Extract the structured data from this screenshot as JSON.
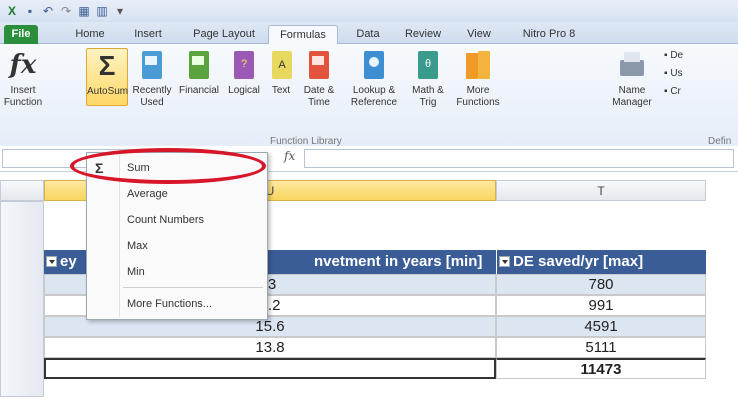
{
  "qa_bar": {
    "icons": [
      "excel-icon",
      "save-icon",
      "undo-icon",
      "redo-icon",
      "table-icon",
      "chart-icon",
      "customize-icon"
    ]
  },
  "tabs": [
    "File",
    "Home",
    "Insert",
    "Page Layout",
    "Formulas",
    "Data",
    "Review",
    "View",
    "Nitro Pro 8"
  ],
  "active_tab": "Formulas",
  "ribbon": {
    "insert_function": "Insert Function",
    "autosum": "AutoSum",
    "recently_used": "Recently Used",
    "financial": "Financial",
    "logical": "Logical",
    "text": "Text",
    "date_time": "Date & Time",
    "lookup_reference": "Lookup & Reference",
    "math_trig": "Math & Trig",
    "more_functions": "More Functions",
    "name_manager": "Name Manager",
    "function_library_label": "Function Library",
    "defined_names_label": "Defin",
    "define_name": "De",
    "use_in_formula": "Us",
    "create": "Cr"
  },
  "formula_bar": {
    "fx": "fx"
  },
  "autosum_menu": {
    "items": [
      "Sum",
      "Average",
      "Count Numbers",
      "Max",
      "Min",
      "More Functions..."
    ]
  },
  "sheet": {
    "col_u": "U",
    "col_t": "T",
    "header_left": "ey",
    "header_u": "nvetment in years [min]",
    "header_t": "DE saved/yr [max]",
    "rows": [
      {
        "u": ".3",
        "t": "780"
      },
      {
        "u": "2.2",
        "t": "991"
      },
      {
        "u": "15.6",
        "t": "4591"
      },
      {
        "u": "13.8",
        "t": "5111"
      }
    ],
    "total": "11473"
  },
  "colors": {
    "accent": "#3b5d97",
    "file_tab": "#2a8f3a",
    "highlight_ring": "#d8162a"
  }
}
